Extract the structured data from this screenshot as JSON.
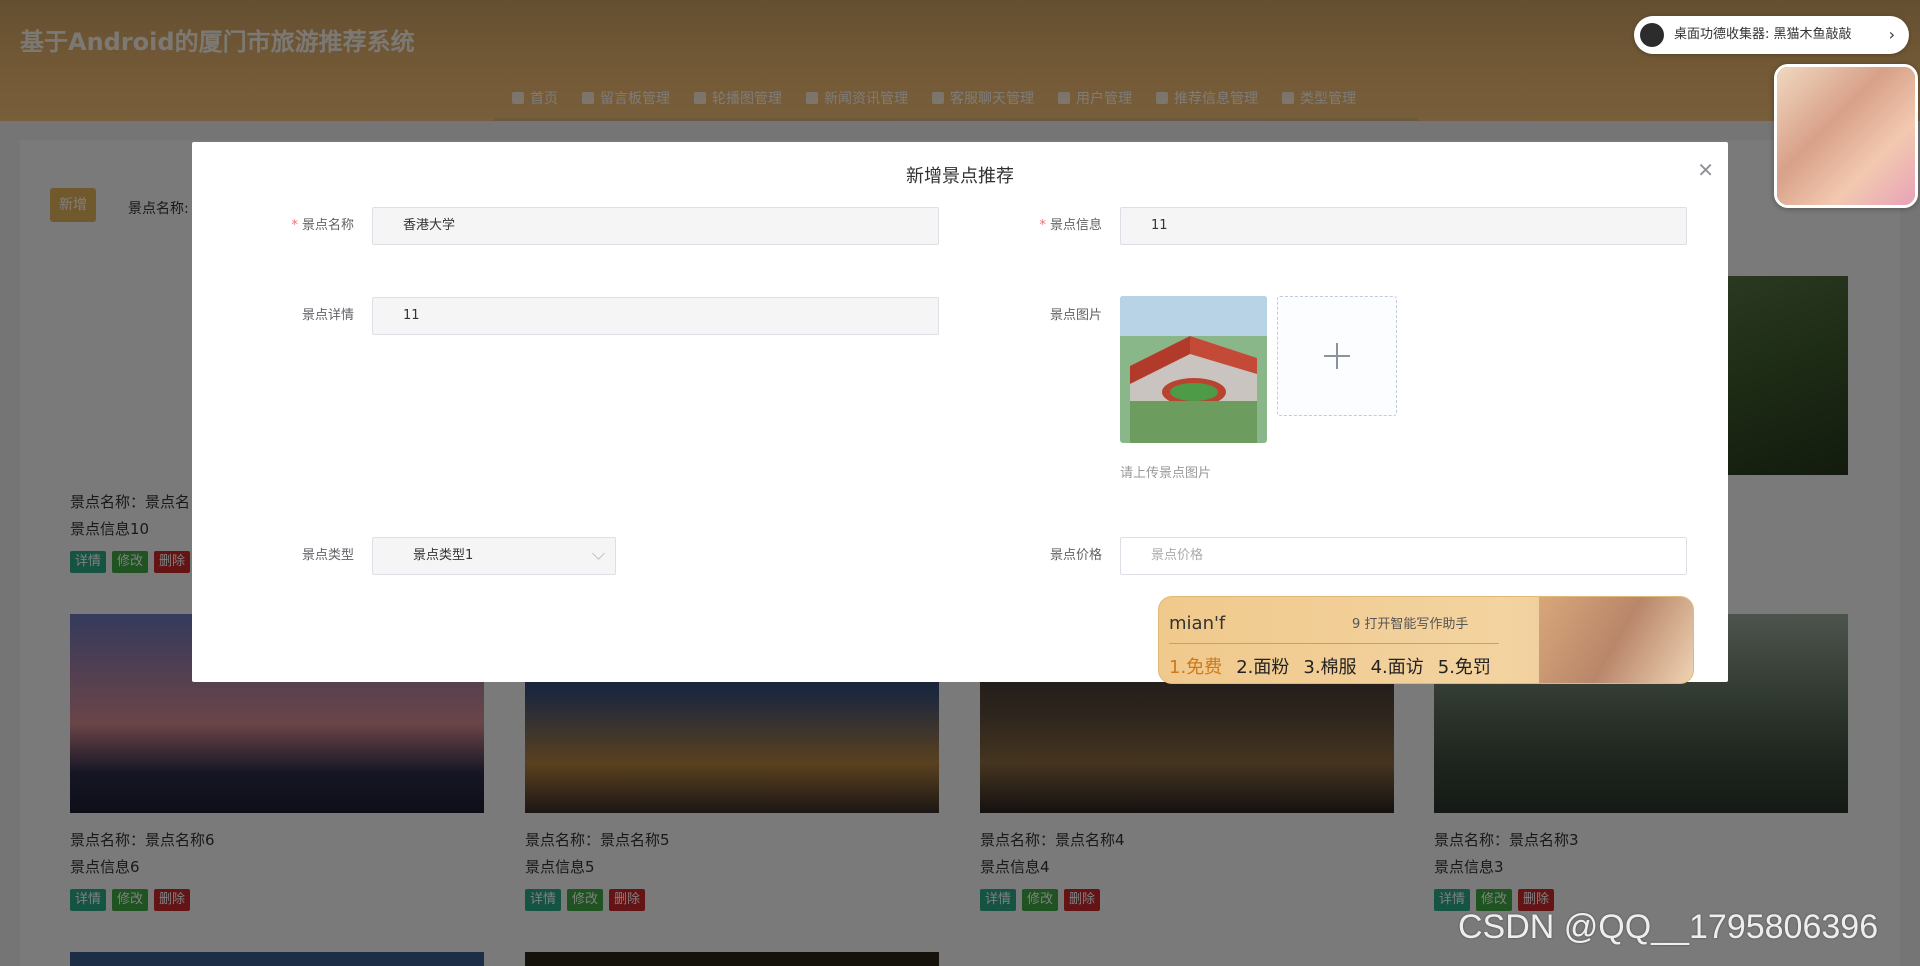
{
  "header": {
    "site_title": "基于Android的厦门市旅游推荐系统",
    "nav": [
      "首页",
      "留言板管理",
      "轮播图管理",
      "新闻资讯管理",
      "客服聊天管理",
      "用户管理",
      "推荐信息管理",
      "类型管理"
    ]
  },
  "toolbar": {
    "add_label": "新增",
    "search_label": "景点名称:"
  },
  "cards": [
    {
      "name": "景点名称：景点名",
      "info": "景点信息10"
    },
    {
      "name": "景点名称：景点名称6",
      "info": "景点信息6"
    },
    {
      "name": "景点名称：景点名称5",
      "info": "景点信息5"
    },
    {
      "name": "景点名称：景点名称4",
      "info": "景点信息4"
    },
    {
      "name": "景点名称：景点名称3",
      "info": "景点信息3"
    }
  ],
  "card_buttons": {
    "detail": "详情",
    "edit": "修改",
    "delete": "删除"
  },
  "modal": {
    "title": "新增景点推荐",
    "fields": {
      "name_label": "景点名称",
      "name_value": "香港大学",
      "info_label": "景点信息",
      "info_value": "11",
      "detail_label": "景点详情",
      "detail_value": "11",
      "image_label": "景点图片",
      "image_hint": "请上传景点图片",
      "type_label": "景点类型",
      "type_value": "景点类型1",
      "price_label": "景点价格",
      "price_placeholder": "景点价格"
    }
  },
  "ime": {
    "input": "mian'f",
    "hint": "9 打开智能写作助手",
    "candidates": [
      "1.免费",
      "2.面粉",
      "3.棉服",
      "4.面访",
      "5.免罚"
    ]
  },
  "widget": {
    "text": "桌面功德收集器: 黑猫木鱼敲敲"
  },
  "watermark": "CSDN @QQ__1795806396"
}
